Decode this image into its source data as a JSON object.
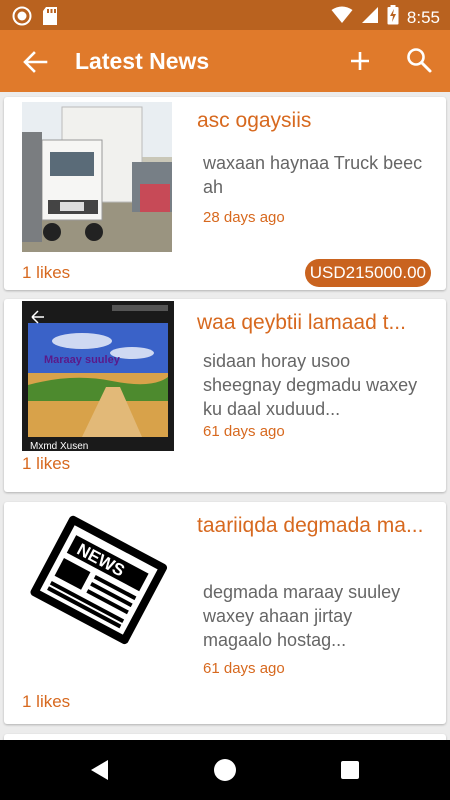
{
  "status_bar": {
    "time": "8:55",
    "icons": [
      "circle-app-icon",
      "sd-card-icon",
      "wifi-icon",
      "signal-icon",
      "battery-charging-icon"
    ]
  },
  "app_bar": {
    "title": "Latest News",
    "icons": [
      "back-arrow-icon",
      "add-icon",
      "search-icon"
    ]
  },
  "news": [
    {
      "title": "asc ogaysiis",
      "description": "waxaan haynaa Truck beec ah",
      "date": "28 days ago",
      "likes": "1 likes",
      "price": "USD215000.00",
      "image": "truck-photo"
    },
    {
      "title": "waa qeybtii lamaad t...",
      "description": "sidaan horay usoo sheegnay degmadu waxey ku daal xuduud...",
      "date": "61 days ago",
      "likes": "1 likes",
      "image": "landscape-photo",
      "image_caption_top": "Maraay suuley",
      "image_caption_bottom": "Mxmd Xusen"
    },
    {
      "title": "taariiqda degmada ma...",
      "description": "degmada maraay suuley waxey ahaan jirtay magaalo hostag...",
      "date": "61 days ago",
      "likes": "1 likes",
      "image": "news-paper-icon"
    }
  ],
  "colors": {
    "status_bar": "#b9621f",
    "app_bar": "#e07a2b",
    "accent_text": "#d7691f",
    "badge": "#c9631f"
  },
  "nav_bar": {
    "icons": [
      "nav-back-icon",
      "nav-home-icon",
      "nav-recent-icon"
    ]
  }
}
